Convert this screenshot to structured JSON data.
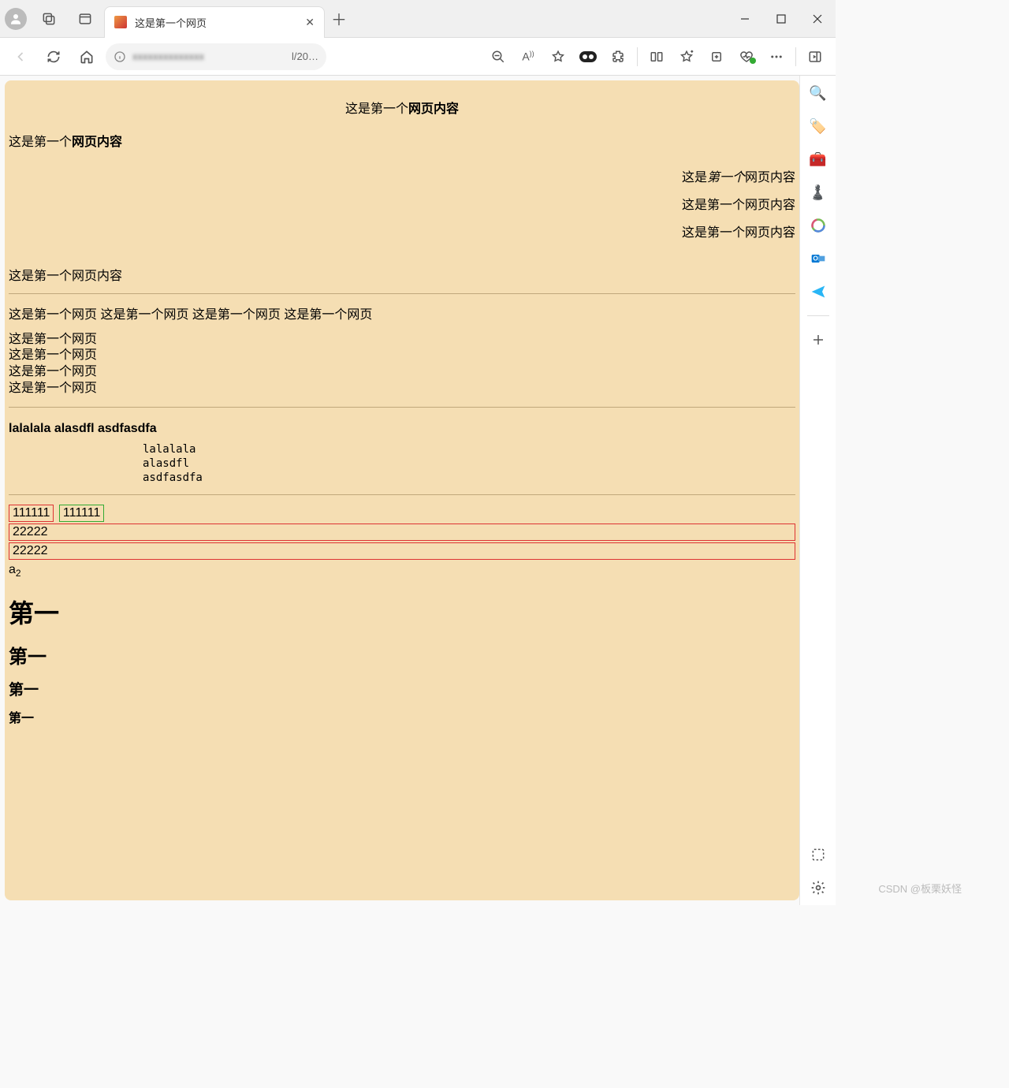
{
  "tab": {
    "title": "这是第一个网页"
  },
  "address": {
    "blurred": "xxxxxxxxxxxxxx",
    "suffix": "l/20…"
  },
  "page": {
    "center_prefix": "这是第一个",
    "center_bold": "网页内容",
    "left_prefix": "这是第一个",
    "left_bold": "网页内容",
    "right_lines": [
      {
        "pre": "这是",
        "italic": "第一个",
        "post": "网页内容"
      },
      {
        "text": "这是第一个网页内容"
      },
      {
        "text": "这是第一个网页内容"
      }
    ],
    "plain": "这是第一个网页内容",
    "repeated_inline": "这是第一个网页 这是第一个网页 这是第一个网页 这是第一个网页",
    "stacked": [
      "这是第一个网页",
      "这是第一个网页",
      "这是第一个网页",
      "这是第一个网页"
    ],
    "sans_heading": "lalalala alasdfl asdfasdfa",
    "pre_lines": "lalalala\nalasdfl\nasdfasdfa",
    "span1": "111111",
    "span2": "111111",
    "div1": "22222",
    "div2": "22222",
    "sub_base": "a",
    "sub_sub": "2",
    "h1": "第一",
    "h2": "第一",
    "h3": "第一",
    "h4": "第一"
  },
  "watermark": "CSDN @板栗妖怪"
}
